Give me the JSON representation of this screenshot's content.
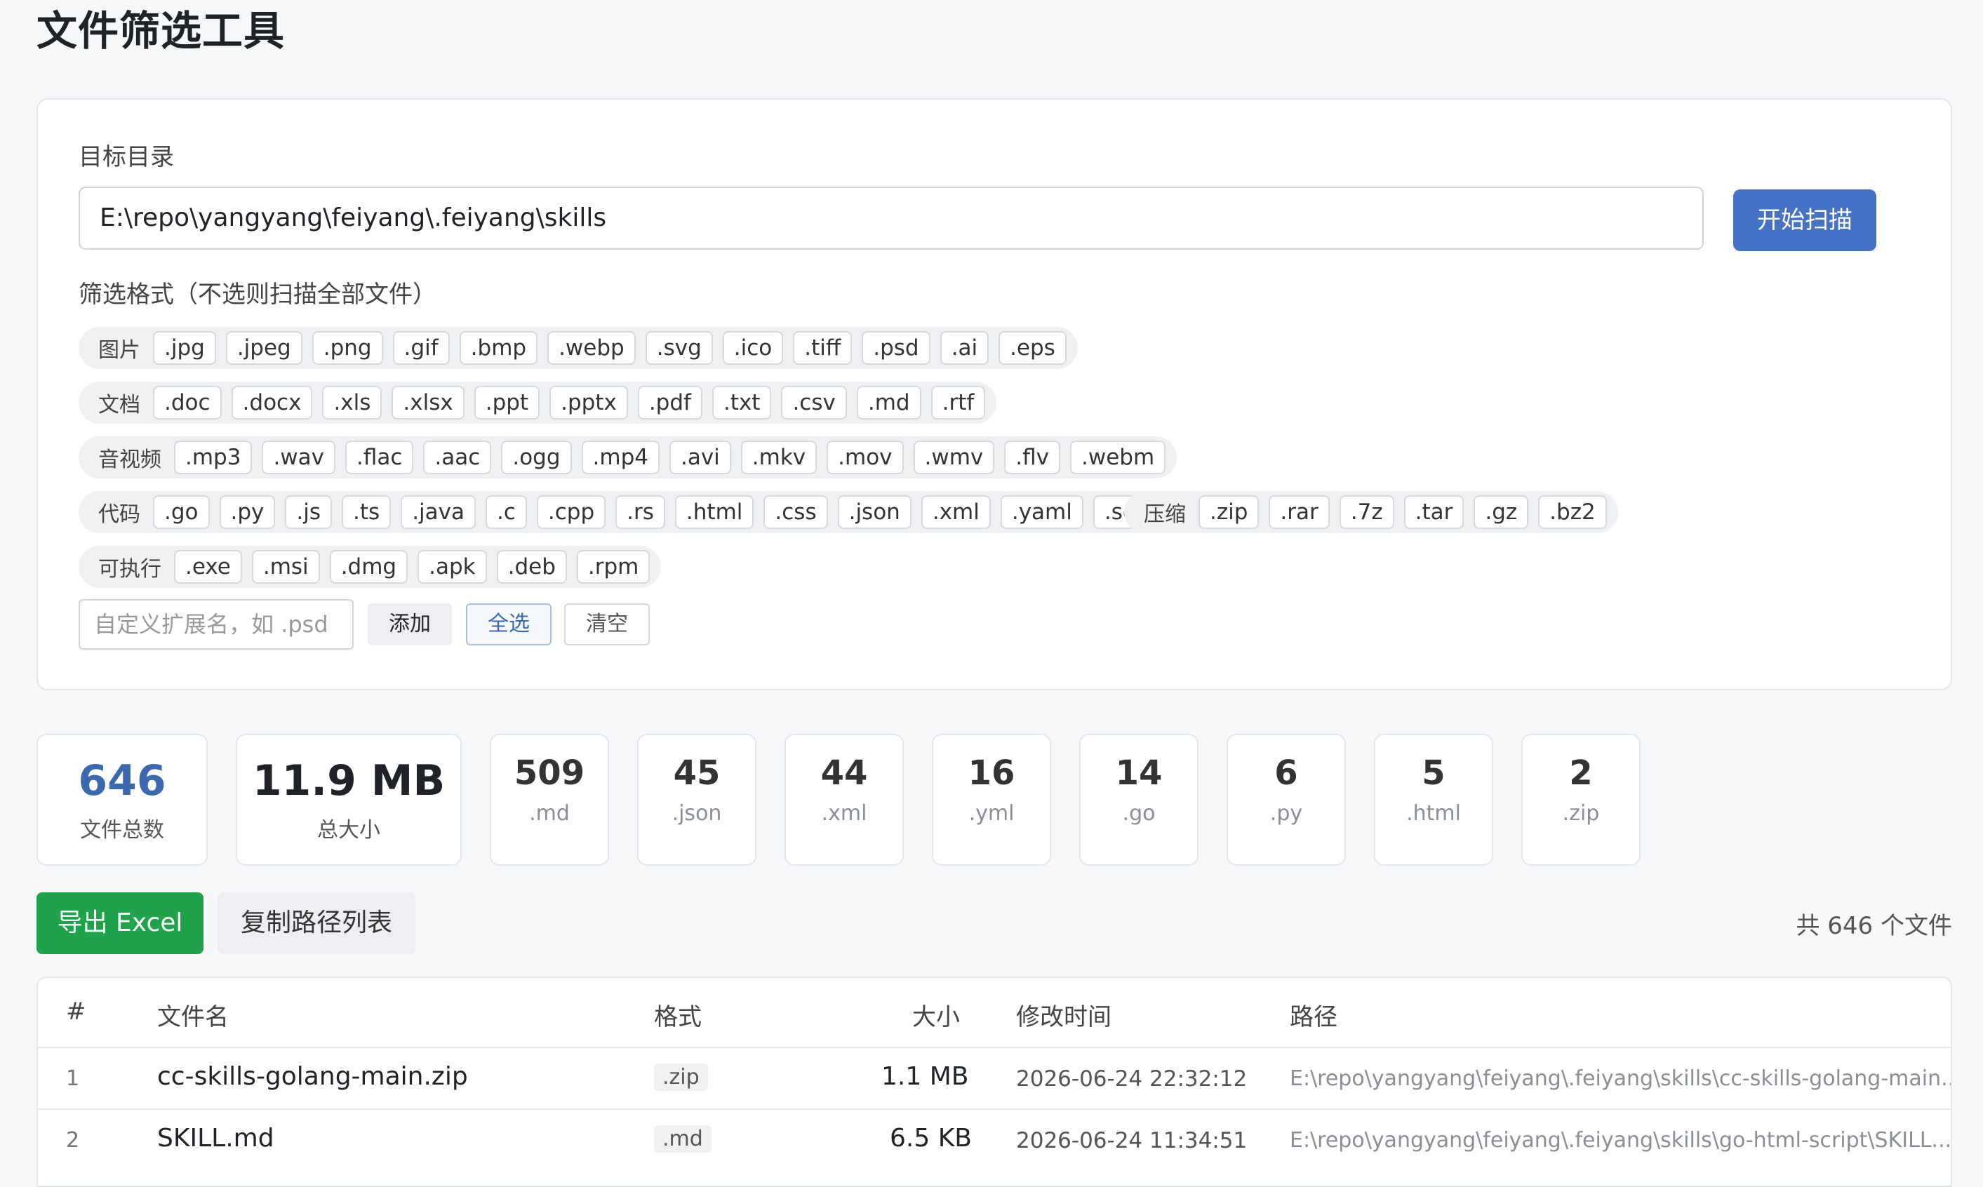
{
  "app": {
    "title": "文件筛选工具"
  },
  "directory": {
    "label": "目标目录",
    "value": "E:\\repo\\yangyang\\feiyang\\.feiyang\\skills",
    "scan_button": "开始扫描"
  },
  "filter": {
    "label": "筛选格式（不选则扫描全部文件）",
    "groups": [
      {
        "label": "图片",
        "exts": [
          ".jpg",
          ".jpeg",
          ".png",
          ".gif",
          ".bmp",
          ".webp",
          ".svg",
          ".ico",
          ".tiff",
          ".psd",
          ".ai",
          ".eps"
        ]
      },
      {
        "label": "文档",
        "exts": [
          ".doc",
          ".docx",
          ".xls",
          ".xlsx",
          ".ppt",
          ".pptx",
          ".pdf",
          ".txt",
          ".csv",
          ".md",
          ".rtf"
        ]
      },
      {
        "label": "音视频",
        "exts": [
          ".mp3",
          ".wav",
          ".flac",
          ".aac",
          ".ogg",
          ".mp4",
          ".avi",
          ".mkv",
          ".mov",
          ".wmv",
          ".flv",
          ".webm"
        ]
      },
      {
        "label": "代码",
        "exts": [
          ".go",
          ".py",
          ".js",
          ".ts",
          ".java",
          ".c",
          ".cpp",
          ".rs",
          ".html",
          ".css",
          ".json",
          ".xml",
          ".yaml",
          ".sql"
        ]
      },
      {
        "label": "压缩",
        "exts": [
          ".zip",
          ".rar",
          ".7z",
          ".tar",
          ".gz",
          ".bz2"
        ]
      },
      {
        "label": "可执行",
        "exts": [
          ".exe",
          ".msi",
          ".dmg",
          ".apk",
          ".deb",
          ".rpm"
        ]
      }
    ],
    "custom_placeholder": "自定义扩展名，如 .psd",
    "add_button": "添加",
    "select_all_button": "全选",
    "clear_button": "清空"
  },
  "stats": {
    "total_count": "646",
    "total_count_label": "文件总数",
    "total_size": "11.9 MB",
    "total_size_label": "总大小",
    "by_ext": [
      {
        "count": "509",
        "ext": ".md"
      },
      {
        "count": "45",
        "ext": ".json"
      },
      {
        "count": "44",
        "ext": ".xml"
      },
      {
        "count": "16",
        "ext": ".yml"
      },
      {
        "count": "14",
        "ext": ".go"
      },
      {
        "count": "6",
        "ext": ".py"
      },
      {
        "count": "5",
        "ext": ".html"
      },
      {
        "count": "2",
        "ext": ".zip"
      }
    ]
  },
  "actions": {
    "export_button": "导出 Excel",
    "copy_button": "复制路径列表",
    "total_text": "共 646 个文件"
  },
  "table": {
    "headers": {
      "index": "#",
      "name": "文件名",
      "format": "格式",
      "size": "大小",
      "mtime": "修改时间",
      "path": "路径"
    },
    "rows": [
      {
        "index": "1",
        "name": "cc-skills-golang-main.zip",
        "format": ".zip",
        "size": "1.1 MB",
        "mtime": "2026-06-24 22:32:12",
        "path": "E:\\repo\\yangyang\\feiyang\\.feiyang\\skills\\cc-skills-golang-main..."
      },
      {
        "index": "2",
        "name": "SKILL.md",
        "format": ".md",
        "size": "6.5 KB",
        "mtime": "2026-06-24 11:34:51",
        "path": "E:\\repo\\yangyang\\feiyang\\.feiyang\\skills\\go-html-script\\SKILL...."
      }
    ]
  }
}
